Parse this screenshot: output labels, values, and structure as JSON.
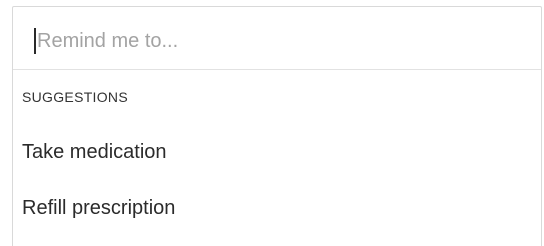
{
  "reminder_input": {
    "value": "",
    "placeholder": "Remind me to..."
  },
  "suggestions": {
    "header": "SUGGESTIONS",
    "items": [
      {
        "label": "Take medication"
      },
      {
        "label": "Refill prescription"
      }
    ]
  }
}
